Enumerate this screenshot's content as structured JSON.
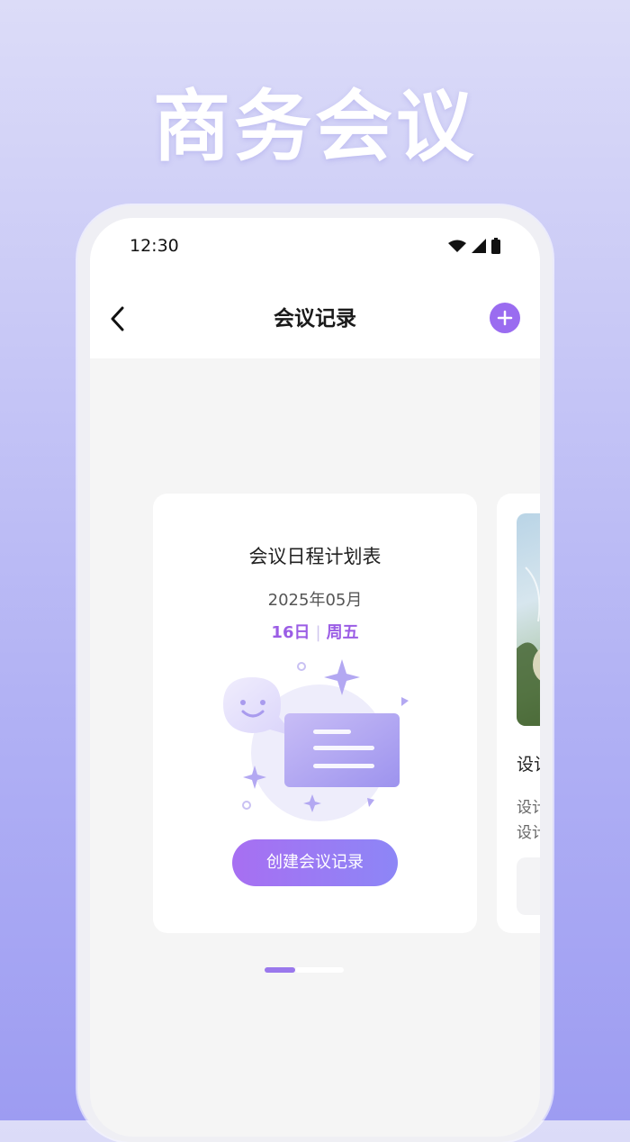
{
  "hero": {
    "title": "商务会议"
  },
  "status_bar": {
    "time": "12:30"
  },
  "nav": {
    "title": "会议记录"
  },
  "card": {
    "title": "会议日程计划表",
    "month": "2025年05月",
    "day": "16日",
    "weekday": "周五",
    "button": "创建会议记录"
  },
  "next_card": {
    "title": "设计",
    "line1": "设计",
    "line2": "设计"
  },
  "pager": {
    "count": 2,
    "active": 0
  },
  "colors": {
    "accent": "#9a6cf0",
    "day_text": "#9b5de5"
  }
}
